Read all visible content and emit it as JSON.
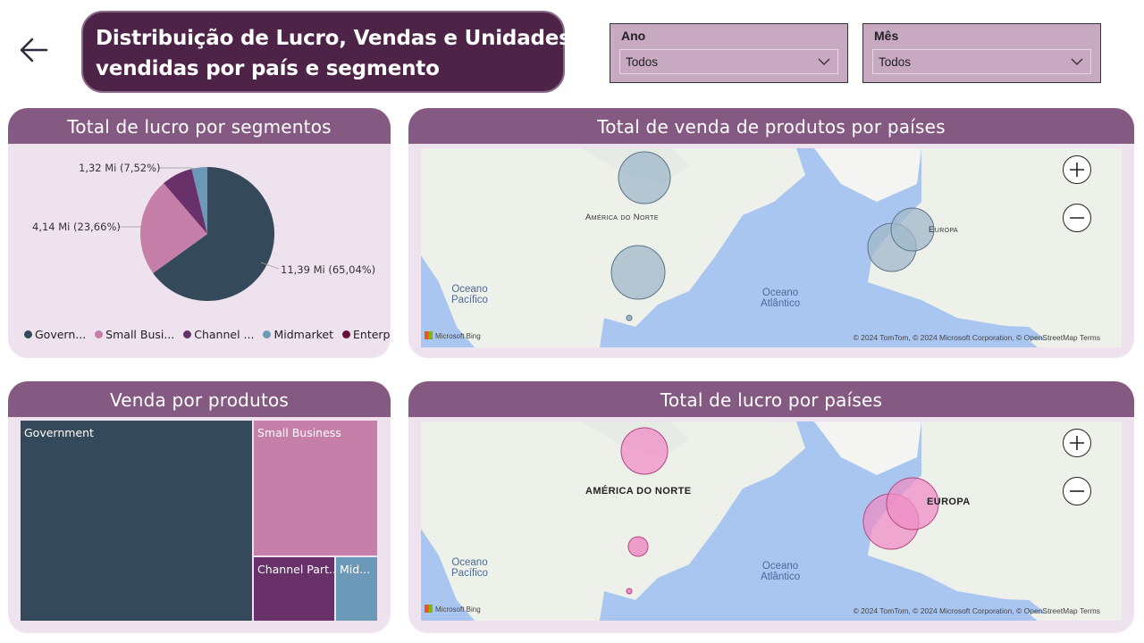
{
  "header": {
    "back_icon": "arrow-left-icon",
    "title_line1": "Distribuição de Lucro, Vendas e Unidades",
    "title_line2": "vendidas por país e segmento"
  },
  "slicers": {
    "year": {
      "label": "Ano",
      "value": "Todos"
    },
    "month": {
      "label": "Mês",
      "value": "Todos"
    }
  },
  "colors": {
    "government": "#344a5a",
    "small_business": "#c67fa8",
    "channel_partners": "#68316a",
    "midmarket": "#6c99b8",
    "enterprise": "#6a0f3c",
    "header_bar": "#845a83",
    "card_bg": "#efe2ef"
  },
  "pie_card": {
    "title": "Total de lucro por segmentos",
    "labels": {
      "government": "11,39 Mi (65,04%)",
      "small_business": "4,14 Mi (23,66%)",
      "channel": "1,32 Mi (7,52%)"
    },
    "legend": [
      "Govern...",
      "Small Busi...",
      "Channel ...",
      "Midmarket",
      "Enterprise"
    ]
  },
  "chart_data": {
    "type": "pie",
    "title": "Total de lucro por segmentos",
    "slices": [
      {
        "name": "Government",
        "value": 11.39,
        "percent": 65.04,
        "color": "#344a5a"
      },
      {
        "name": "Small Business",
        "value": 4.14,
        "percent": 23.66,
        "color": "#c67fa8"
      },
      {
        "name": "Channel Partners",
        "value": 1.32,
        "percent": 7.52,
        "color": "#68316a"
      },
      {
        "name": "Midmarket",
        "value": 0.66,
        "percent": 3.78,
        "color": "#6c99b8"
      },
      {
        "name": "Enterprise",
        "value": 0.0,
        "percent": 0.0,
        "color": "#6a0f3c"
      }
    ],
    "unit": "Mi"
  },
  "sales_map": {
    "title": "Total de venda de produtos por países",
    "labels": {
      "north_america": "América do Norte",
      "europe": "Europa",
      "pacific_1": "Oceano",
      "pacific_2": "Pacífico",
      "atlantic_1": "Oceano",
      "atlantic_2": "Atlântico"
    },
    "attribution": "© 2024 TomTom, © 2024 Microsoft Corporation, © OpenStreetMap  Terms",
    "brand": "Microsoft Bing"
  },
  "treemap": {
    "title": "Venda por produtos",
    "tiles": [
      "Government",
      "Small Business",
      "Channel Part...",
      "Mid..."
    ]
  },
  "profit_map": {
    "title": "Total de lucro por países",
    "labels": {
      "north_america": "AMÉRICA DO NORTE",
      "europe": "EUROPA",
      "pacific_1": "Oceano",
      "pacific_2": "Pacífico",
      "atlantic_1": "Oceano",
      "atlantic_2": "Atlântico"
    },
    "attribution": "© 2024 TomTom, © 2024 Microsoft Corporation, © OpenStreetMap  Terms",
    "brand": "Microsoft Bing"
  },
  "map_controls": {
    "zoom_in_icon": "plus-icon",
    "zoom_out_icon": "minus-icon"
  }
}
